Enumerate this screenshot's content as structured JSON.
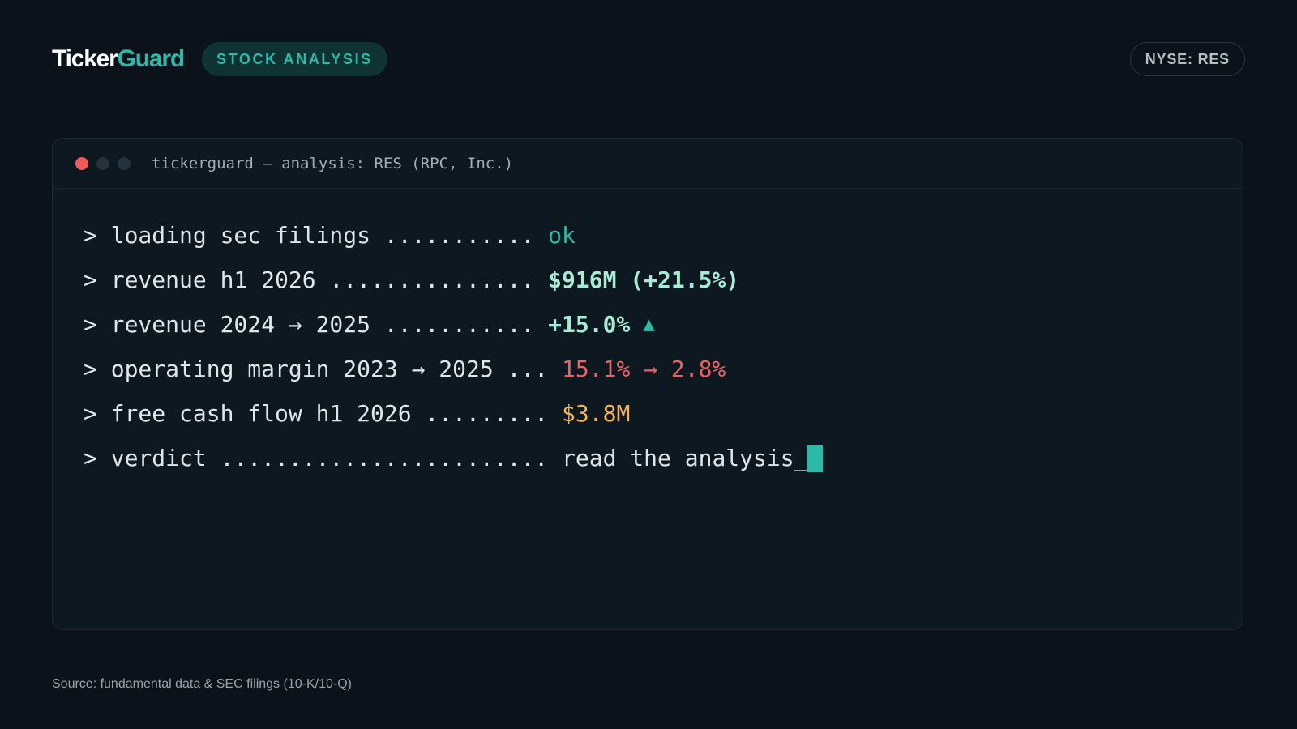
{
  "header": {
    "logo_part1": "Ticker",
    "logo_part2": "Guard",
    "badge": "STOCK ANALYSIS",
    "ticker": "NYSE: RES"
  },
  "terminal": {
    "title": "tickerguard — analysis: RES (RPC, Inc.)",
    "lines": [
      {
        "prefix": "> loading sec filings ........... ",
        "value": "ok"
      },
      {
        "prefix": "> revenue h1 2026 ............... ",
        "value": "$916M (+21.5%)"
      },
      {
        "prefix": "> revenue 2024 → 2025 ........... ",
        "value": "+15.0%",
        "trend_icon": "▲"
      },
      {
        "prefix": "> operating margin 2023 → 2025 ... ",
        "value": "15.1% → 2.8%"
      },
      {
        "prefix": "> free cash flow h1 2026 ......... ",
        "value": "$3.8M"
      },
      {
        "prefix": "> verdict ........................ ",
        "value": "read the analysis_"
      }
    ]
  },
  "footer": {
    "source": "Source: fundamental data & SEC filings (10-K/10-Q)"
  },
  "colors": {
    "accent": "#2fb9a8",
    "positive": "#a8ecd6",
    "negative": "#ef6060",
    "warning": "#f3b452",
    "background": "#0b121a"
  },
  "icons": {
    "window_controls": [
      "close-dot",
      "minimize-dot",
      "maximize-dot"
    ],
    "trend": "up-triangle-icon",
    "cursor": "block-cursor-icon"
  }
}
